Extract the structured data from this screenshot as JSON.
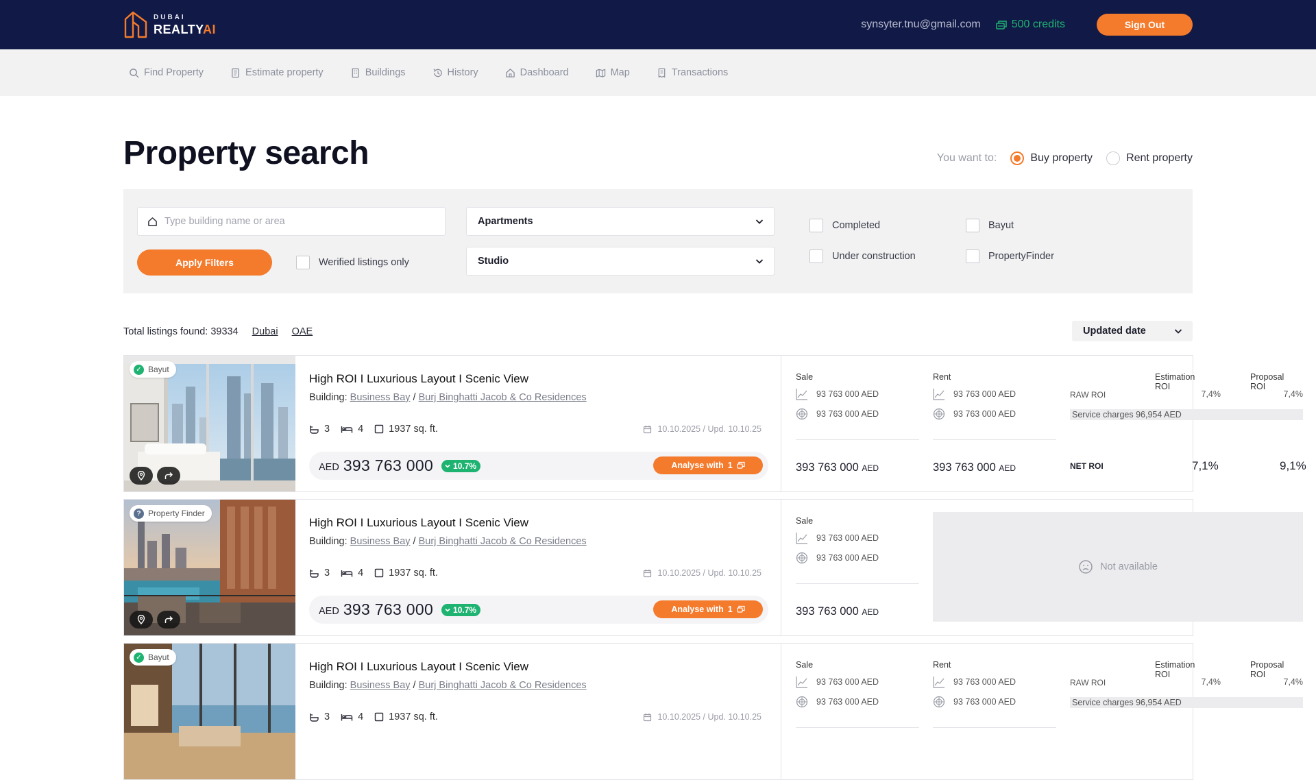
{
  "brand": {
    "top": "DUBAI",
    "main": "REALTY",
    "accent": "AI"
  },
  "header": {
    "email": "synsyter.tnu@gmail.com",
    "credits": "500 credits",
    "sign_out": "Sign Out"
  },
  "nav": [
    {
      "label": "Find Property",
      "icon": "search-icon"
    },
    {
      "label": "Estimate property",
      "icon": "document-icon"
    },
    {
      "label": "Buildings",
      "icon": "building-icon"
    },
    {
      "label": "History",
      "icon": "history-icon"
    },
    {
      "label": "Dashboard",
      "icon": "home-icon"
    },
    {
      "label": "Map",
      "icon": "map-icon"
    },
    {
      "label": "Transactions",
      "icon": "receipt-icon"
    }
  ],
  "page": {
    "title": "Property search",
    "want_label": "You want to:",
    "buy": "Buy property",
    "rent": "Rent property",
    "selected": "buy"
  },
  "filters": {
    "search_placeholder": "Type building name or area",
    "search_value": "",
    "apply": "Apply Filters",
    "verified": "Werified listings only",
    "type_value": "Apartments",
    "rooms_value": "Studio",
    "completed": "Completed",
    "under_construction": "Under construction",
    "bayut": "Bayut",
    "property_finder": "PropertyFinder"
  },
  "results": {
    "total": "Total listings found: 39334",
    "loc1": "Dubai",
    "loc2": "OAE",
    "sort": "Updated date"
  },
  "labels": {
    "building_prefix": "Building:",
    "sep": "/",
    "currency": "AED",
    "analyse": "Analyse with",
    "analyse_count": "1",
    "sale": "Sale",
    "rent": "Rent",
    "estimation_roi": "Estimation ROI",
    "proposal_roi": "Proposal ROI",
    "raw_roi": "RAW ROI",
    "net_roi": "NET ROI",
    "not_available": "Not available"
  },
  "listings": [
    {
      "source": "Bayut",
      "title": "High ROI I Luxurious Layout I Scenic View",
      "area": "Business Bay",
      "building": "Burj Binghatti Jacob & Co Residences",
      "baths": "3",
      "beds": "4",
      "size": "1937 sq. ft.",
      "dates": "10.10.2025 /  Upd. 10.10.25",
      "price": "393 763 000",
      "growth": "10.7%",
      "sale": {
        "v1": "93 763 000 AED",
        "v2": "93 763 000 AED",
        "total": "393 763 000",
        "unit": "AED"
      },
      "rent": {
        "v1": "93 763 000 AED",
        "v2": "93 763 000 AED",
        "total": "393 763 000",
        "unit": "AED"
      },
      "raw_est": "7,4%",
      "raw_prop": "7,4%",
      "service": "Service charges  96,954 AED",
      "net_est": "7,1%",
      "net_prop": "9,1%"
    },
    {
      "source": "Property Finder",
      "title": "High ROI I Luxurious Layout I Scenic View",
      "area": "Business Bay",
      "building": "Burj Binghatti Jacob & Co Residences",
      "baths": "3",
      "beds": "4",
      "size": "1937 sq. ft.",
      "dates": "10.10.2025 /  Upd. 10.10.25",
      "price": "393 763 000",
      "growth": "10.7%",
      "sale": {
        "v1": "93 763 000 AED",
        "v2": "93 763 000 AED",
        "total": "393 763 000",
        "unit": "AED"
      }
    },
    {
      "source": "Bayut",
      "title": "High ROI I Luxurious Layout I Scenic View",
      "area": "Business Bay",
      "building": "Burj Binghatti Jacob & Co Residences",
      "baths": "3",
      "beds": "4",
      "size": "1937 sq. ft.",
      "dates": "10.10.2025 /  Upd. 10.10.25",
      "sale": {
        "v1": "93 763 000 AED",
        "v2": "93 763 000 AED"
      },
      "rent": {
        "v1": "93 763 000 AED",
        "v2": "93 763 000 AED"
      },
      "raw_est": "7,4%",
      "raw_prop": "7,4%",
      "service": "Service charges  96,954 AED"
    }
  ],
  "colors": {
    "navy": "#111a47",
    "accent": "#f47a2c",
    "green": "#1fb372",
    "panel": "#f2f2f3"
  }
}
